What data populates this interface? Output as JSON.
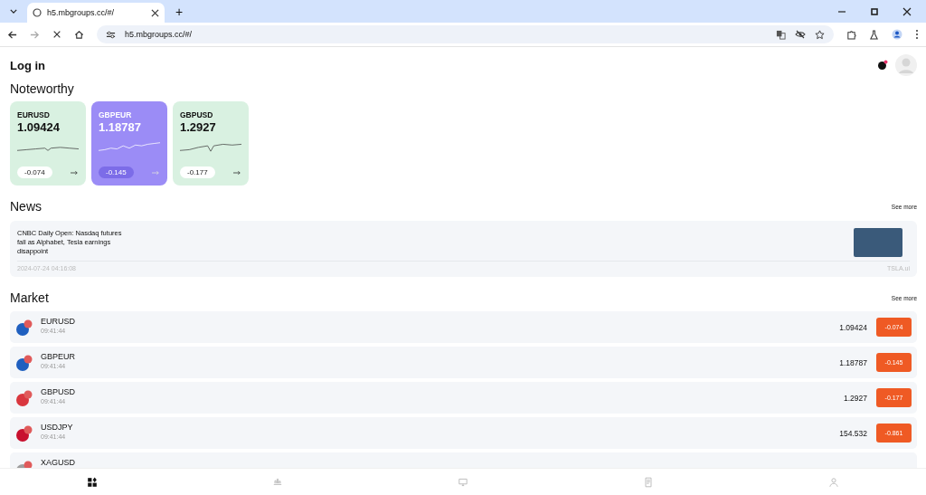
{
  "browser": {
    "tab": {
      "title": "h5.mbgroups.cc/#/",
      "selected": true
    },
    "new_tab": "+",
    "address": "h5.mbgroups.cc/#/",
    "loading": true
  },
  "header": {
    "title": "Log in"
  },
  "noteworthy": {
    "title": "Noteworthy",
    "cards": [
      {
        "symbol": "EURUSD",
        "price": "1.09424",
        "change": "-0.074",
        "selected": false
      },
      {
        "symbol": "GBPEUR",
        "price": "1.18787",
        "change": "-0.145",
        "selected": true
      },
      {
        "symbol": "GBPUSD",
        "price": "1.2927",
        "change": "-0.177",
        "selected": false
      }
    ]
  },
  "news": {
    "title": "News",
    "see_more": "See more",
    "items": [
      {
        "headline": "CNBC Daily Open: Nasdaq futures fall as Alphabet, Tesla earnings disappoint",
        "date": "2024-07-24 04:16:08",
        "tag": "TSLA.ui"
      }
    ]
  },
  "market": {
    "title": "Market",
    "see_more": "See more",
    "rows": [
      {
        "symbol": "EURUSD",
        "time": "09:41:44",
        "price": "1.09424",
        "change": "-0.074",
        "color": "#1f5fbf"
      },
      {
        "symbol": "GBPEUR",
        "time": "09:41:44",
        "price": "1.18787",
        "change": "-0.145",
        "color": "#1f5fbf"
      },
      {
        "symbol": "GBPUSD",
        "time": "09:41:44",
        "price": "1.2927",
        "change": "-0.177",
        "color": "#d9363e"
      },
      {
        "symbol": "USDJPY",
        "time": "09:41:44",
        "price": "154.532",
        "change": "-0.861",
        "color": "#c8102e"
      },
      {
        "symbol": "XAGUSD",
        "color": "#9e9e9e"
      }
    ]
  },
  "bottom_nav": [
    {
      "kind": "home",
      "selected": true
    },
    {
      "kind": "chart",
      "selected": false
    },
    {
      "kind": "monitor",
      "selected": false
    },
    {
      "kind": "document",
      "selected": false
    },
    {
      "kind": "user",
      "selected": false
    }
  ]
}
